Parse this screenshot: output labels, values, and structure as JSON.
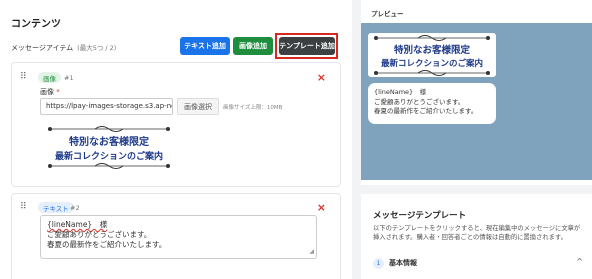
{
  "content": {
    "title": "コンテンツ",
    "items_label": "メッセージアイテム",
    "items_count": "(最大5つ / 2)",
    "buttons": {
      "add_text": "テキスト追加",
      "add_image": "画像追加",
      "add_template": "テンプレート追加"
    }
  },
  "item1": {
    "badge": "画像",
    "number": "#1",
    "field_label": "画像",
    "required_mark": "*",
    "url_value": "https://lpay-images-storage.s3.ap-nor",
    "select_button": "画像選択",
    "size_note": "画像サイズ上限：10MB",
    "banner_line1": "特別なお客様限定",
    "banner_line2": "最新コレクションのご案内",
    "close": "×"
  },
  "item2": {
    "badge": "テキスト",
    "number": "#2",
    "text_lines": [
      "{lineName}　様",
      "ご愛顧ありがとうございます。",
      "春夏の最新作をご紹介いたします。"
    ],
    "close": "×"
  },
  "preview": {
    "title": "プレビュー",
    "banner_line1": "特別なお客様限定",
    "banner_line2": "最新コレクションのご案内",
    "bubble_lines": [
      "{lineName}　様",
      "ご愛顧ありがとうございます。",
      "春夏の最新作をご紹介いたします。"
    ]
  },
  "templates": {
    "title": "メッセージテンプレート",
    "description": "以下のテンプレートをクリックすると、現在編集中のメッセージに文章が挿入されます。購入者・回答者ごとの情報は自動的に置換されます。",
    "accordion_num": "1",
    "accordion_label": "基本情報",
    "accordion_chevron": "^"
  },
  "colors": {
    "primary": "#1a73e8",
    "success": "#1e8e3e",
    "dark": "#3c4043",
    "danger": "#d93025",
    "highlight": "#d9281f",
    "preview_bg": "#7fa3bc"
  }
}
